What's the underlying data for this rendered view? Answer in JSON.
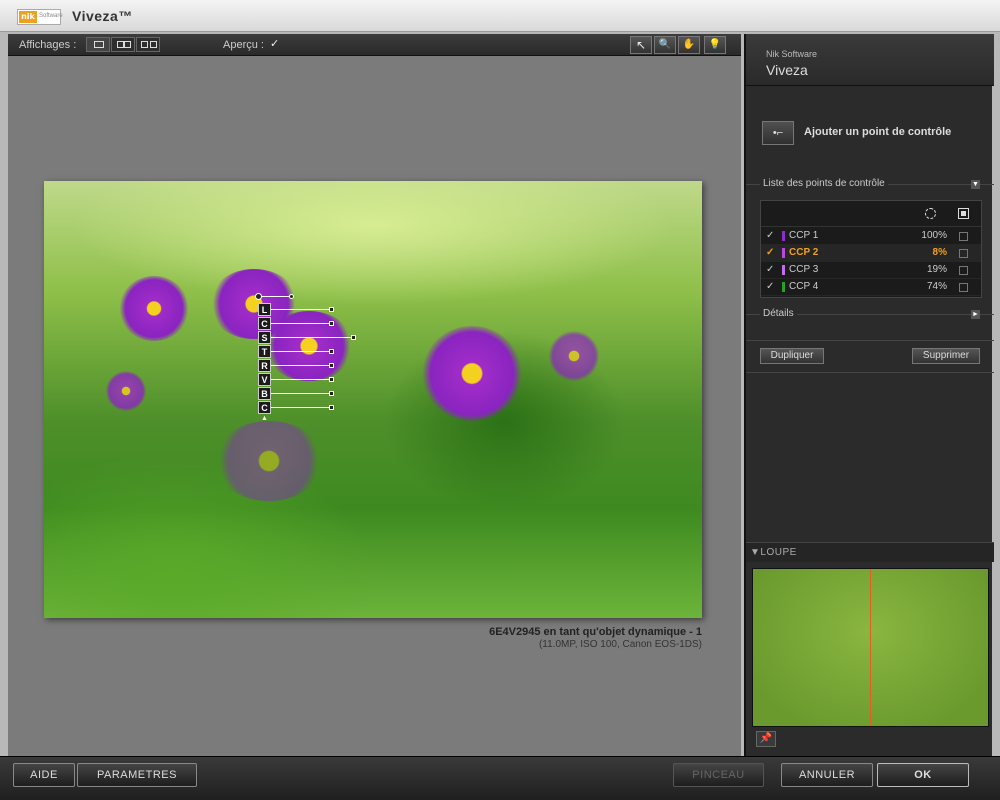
{
  "window": {
    "title": "Viveza™",
    "logo_text": "nik",
    "logo_sub": "Software"
  },
  "toolbar": {
    "views_label": "Affichages :",
    "views": [
      "single-view",
      "split-view",
      "side-by-side-view"
    ],
    "preview_label": "Aperçu :",
    "preview_checked": true,
    "preview_check_glyph": "✓",
    "tools": [
      {
        "name": "select-tool-icon",
        "glyph": "↖"
      },
      {
        "name": "zoom-tool-icon",
        "glyph": "🔍"
      },
      {
        "name": "hand-tool-icon",
        "glyph": "✋"
      },
      {
        "name": "bulb-tool-icon",
        "glyph": "💡"
      }
    ]
  },
  "image": {
    "caption_title": "6E4V2945 en tant qu'objet dynamique - 1",
    "caption_details": "(11.0MP, ISO 100, Canon EOS-1DS)",
    "control_point_sliders": [
      "L",
      "C",
      "S",
      "T",
      "R",
      "V",
      "B",
      "C"
    ]
  },
  "panel": {
    "brand_company": "Nik Software",
    "brand_product": "Viveza",
    "add_point_icon": "•⌐",
    "add_point_label": "Ajouter un point de contrôle",
    "list_section_label": "Liste des points de contrôle",
    "list_section_toggle": "▼",
    "control_points": [
      {
        "name": "CCP 1",
        "percent": "100%",
        "checked": true,
        "selected": false,
        "color": "#8a2ec8"
      },
      {
        "name": "CCP 2",
        "percent": "8%",
        "checked": true,
        "selected": true,
        "color": "#b848e0"
      },
      {
        "name": "CCP 3",
        "percent": "19%",
        "checked": true,
        "selected": false,
        "color": "#c070e8"
      },
      {
        "name": "CCP 4",
        "percent": "74%",
        "checked": true,
        "selected": false,
        "color": "#28a028"
      }
    ],
    "details_label": "Détails",
    "details_toggle": "►",
    "duplicate_label": "Dupliquer",
    "delete_label": "Supprimer",
    "loupe_label": "▼LOUPE",
    "pin_glyph": "📌"
  },
  "bottom": {
    "help_label": "AIDE",
    "settings_label": "PARAMETRES",
    "brush_label": "PINCEAU",
    "cancel_label": "ANNULER",
    "ok_label": "OK"
  },
  "colors": {
    "accent": "#f0a020",
    "loupe_line": "#e06020"
  }
}
